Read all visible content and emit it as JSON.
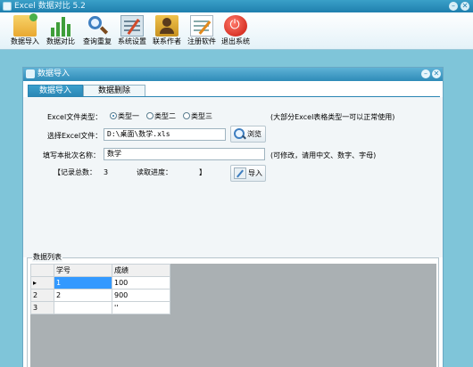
{
  "app": {
    "title": "Excel 数据对比 5.2"
  },
  "toolbar": {
    "items": [
      {
        "label": "数据导入",
        "icon": "folder-import-icon"
      },
      {
        "label": "数据对比",
        "icon": "bar-chart-icon"
      },
      {
        "label": "查询重复",
        "icon": "magnifier-icon"
      },
      {
        "label": "系统设置",
        "icon": "settings-icon"
      },
      {
        "label": "联系作者",
        "icon": "contact-icon"
      },
      {
        "label": "注册软件",
        "icon": "register-icon"
      },
      {
        "label": "退出系统",
        "icon": "power-icon"
      }
    ]
  },
  "dialog": {
    "title": "数据导入",
    "tabs": [
      {
        "label": "数据导入",
        "active": true
      },
      {
        "label": "数据删除",
        "active": false
      }
    ],
    "form": {
      "type_label": "Excel文件类型：",
      "radios": [
        {
          "label": "类型一",
          "checked": true
        },
        {
          "label": "类型二",
          "checked": false
        },
        {
          "label": "类型三",
          "checked": false
        }
      ],
      "type_hint": "(大部分Excel表格类型一可以正常使用)",
      "file_label": "选择Excel文件：",
      "file_value": "D:\\桌面\\数学.xls",
      "browse_label": "浏览",
      "batch_label": "填写本批次名称：",
      "batch_value": "数学",
      "batch_hint": "(可修改，请用中文、数字、字母)",
      "record_total_label": "【记录总数：",
      "record_total_value": "3",
      "progress_label": "读取进度：",
      "progress_close": "】",
      "import_label": "导入"
    },
    "list": {
      "caption": "数据列表",
      "columns": [
        "学号",
        "成绩"
      ],
      "rows": [
        {
          "marker": "▸",
          "cells": [
            "1",
            "100"
          ]
        },
        {
          "marker": "2",
          "cells": [
            "2",
            "900"
          ]
        },
        {
          "marker": "3",
          "cells": [
            "",
            "''"
          ]
        }
      ]
    }
  },
  "colors": {
    "titlebar": "#2e8bb8",
    "background": "#7fc5d9",
    "selection": "#3399ff"
  }
}
